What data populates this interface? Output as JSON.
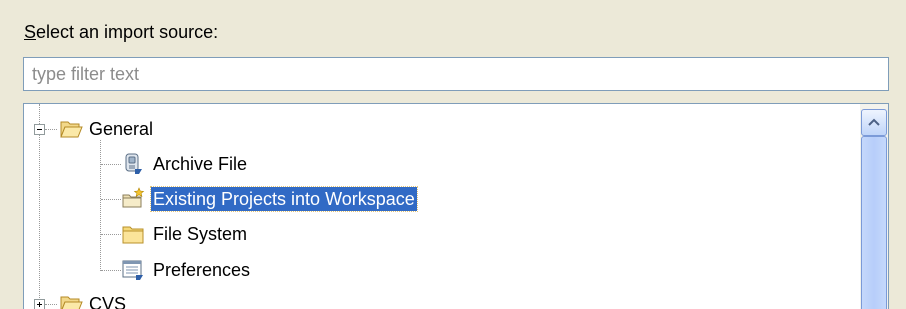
{
  "prompt": {
    "mnemonic": "S",
    "rest": "elect an import source:"
  },
  "filter": {
    "value": "",
    "placeholder": "type filter text"
  },
  "tree": {
    "items": [
      {
        "label": "General",
        "icon": "open-folder-icon",
        "expanded": true,
        "selected": false
      },
      {
        "label": "Archive File",
        "icon": "archive-file-icon",
        "selected": false
      },
      {
        "label": "Existing Projects into Workspace",
        "icon": "existing-projects-icon",
        "selected": true
      },
      {
        "label": "File System",
        "icon": "folder-icon",
        "selected": false
      },
      {
        "label": "Preferences",
        "icon": "preferences-icon",
        "selected": false
      },
      {
        "label": "CVS",
        "icon": "open-folder-icon",
        "expanded": false,
        "selected": false
      }
    ]
  },
  "colors": {
    "selection": "#316ac5",
    "window": "#ece9d8",
    "border": "#7f9db9"
  }
}
